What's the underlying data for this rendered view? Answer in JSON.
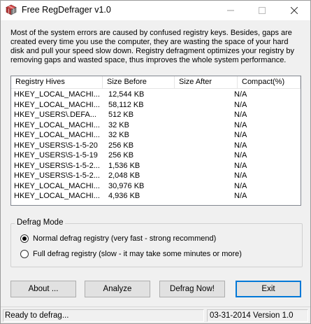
{
  "window": {
    "title": "Free RegDefrager v1.0"
  },
  "intro_text": "Most of the system errors are caused by confused registry keys. Besides, gaps are created every time you use the computer, they are wasting the space of your hard disk and pull your speed slow down. Registry defragment optimizes your registry by removing gaps and wasted space, thus improves the whole system performance.",
  "table": {
    "headers": [
      "Registry Hives",
      "Size Before",
      "Size After",
      "Compact(%)"
    ],
    "rows": [
      [
        "HKEY_LOCAL_MACHI...",
        "12,544 KB",
        "",
        "N/A"
      ],
      [
        "HKEY_LOCAL_MACHI...",
        "58,112 KB",
        "",
        "N/A"
      ],
      [
        "HKEY_USERS\\.DEFA...",
        "512 KB",
        "",
        "N/A"
      ],
      [
        "HKEY_LOCAL_MACHI...",
        "32 KB",
        "",
        "N/A"
      ],
      [
        "HKEY_LOCAL_MACHI...",
        "32 KB",
        "",
        "N/A"
      ],
      [
        "HKEY_USERS\\S-1-5-20",
        "256 KB",
        "",
        "N/A"
      ],
      [
        "HKEY_USERS\\S-1-5-19",
        "256 KB",
        "",
        "N/A"
      ],
      [
        "HKEY_USERS\\S-1-5-2...",
        "1,536 KB",
        "",
        "N/A"
      ],
      [
        "HKEY_USERS\\S-1-5-2...",
        "2,048 KB",
        "",
        "N/A"
      ],
      [
        "HKEY_LOCAL_MACHI...",
        "30,976 KB",
        "",
        "N/A"
      ],
      [
        "HKEY_LOCAL_MACHI...",
        "4,936 KB",
        "",
        "N/A"
      ]
    ]
  },
  "defrag_mode": {
    "label": "Defrag Mode",
    "options": [
      {
        "label": "Normal defrag registry (very fast - strong recommend)",
        "checked": true
      },
      {
        "label": "Full defrag registry (slow - it may take some minutes or more)",
        "checked": false
      }
    ]
  },
  "buttons": {
    "about": "About ...",
    "analyze": "Analyze",
    "defrag": "Defrag Now!",
    "exit": "Exit"
  },
  "status": {
    "left": "Ready to defrag...",
    "right": "03-31-2014 Version 1.0"
  }
}
